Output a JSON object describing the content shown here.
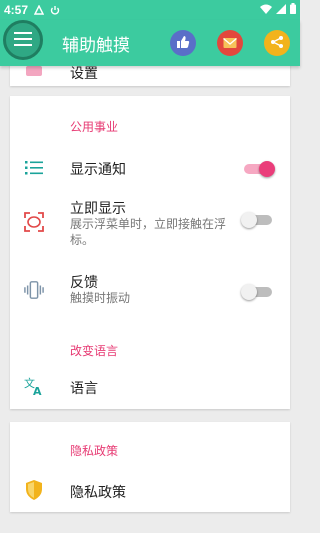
{
  "status_bar": {
    "time": "4:57"
  },
  "app_bar": {
    "title": "辅助触摸"
  },
  "colors": {
    "primary": "#3ccb9f",
    "accent": "#e73a73",
    "icon_teal": "#1aa39a",
    "icon_red": "#e24a4a"
  },
  "top_card": {
    "partial_label": "设置"
  },
  "public_section": {
    "title": "公用事业",
    "show_notification": {
      "label": "显示通知",
      "enabled": true
    },
    "show_immediately": {
      "label": "立即显示",
      "description": "展示浮菜单时，立即接触在浮标。",
      "enabled": false
    },
    "feedback": {
      "label": "反馈",
      "description": "触摸时振动",
      "enabled": false
    },
    "language_title": "改变语言",
    "language": {
      "label": "语言"
    }
  },
  "privacy_section": {
    "title": "隐私政策",
    "privacy": {
      "label": "隐私政策"
    }
  }
}
